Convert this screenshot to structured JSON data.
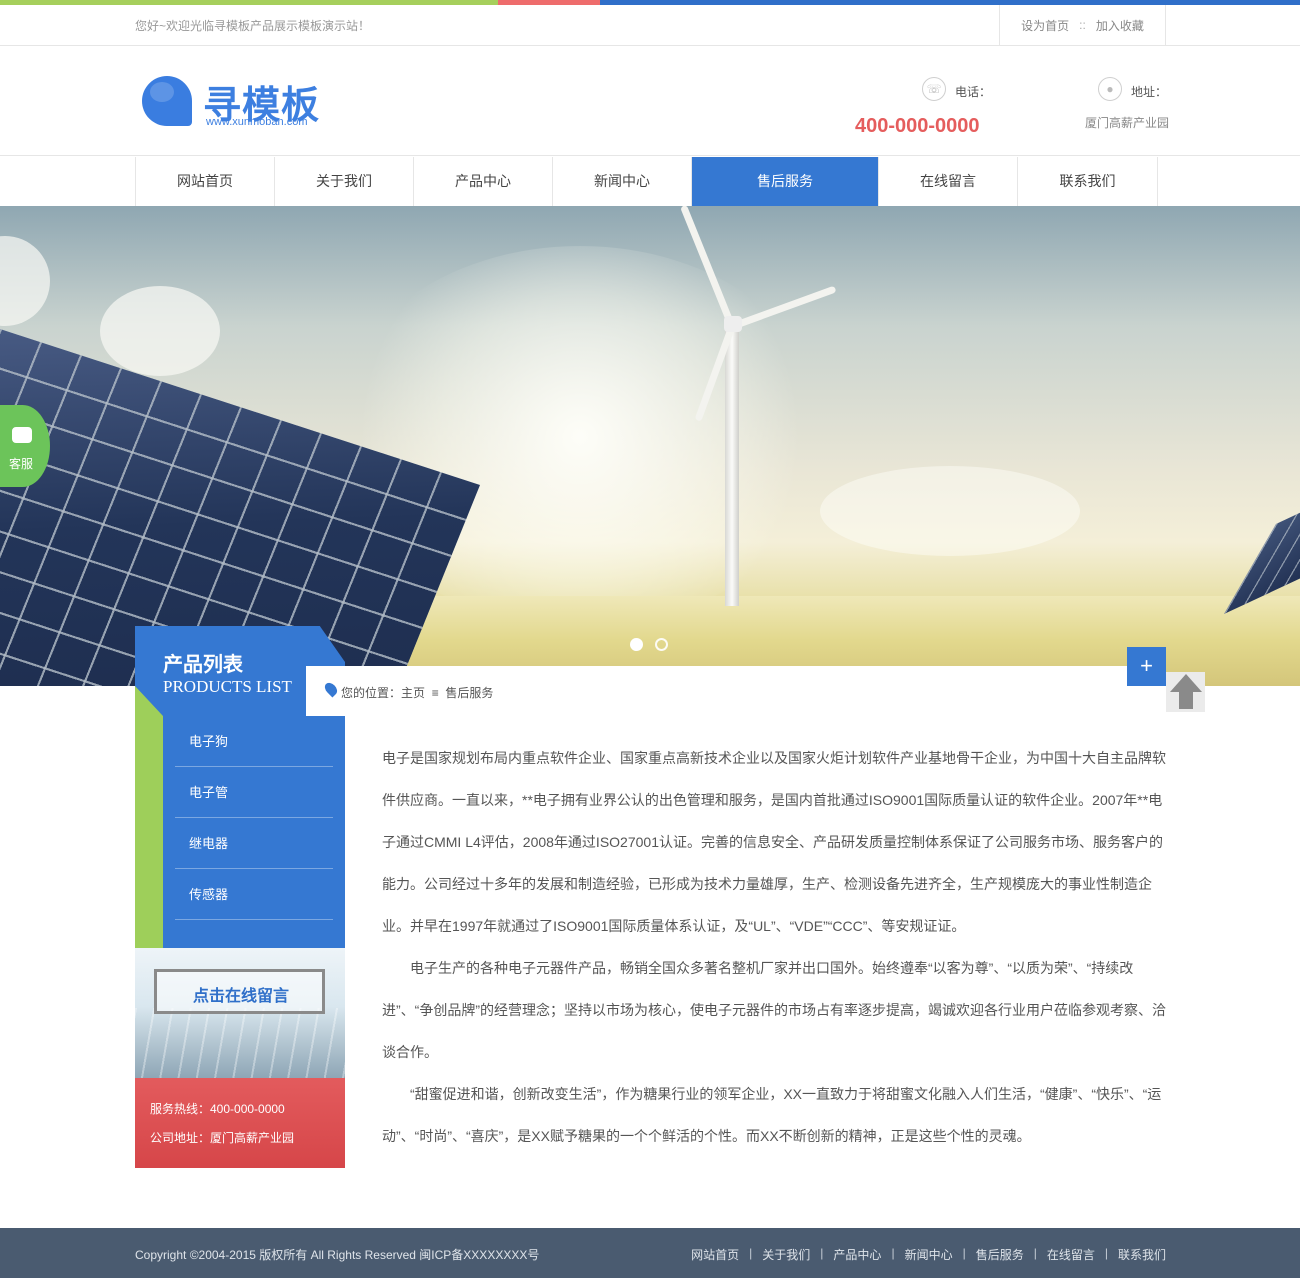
{
  "topbar": {
    "welcome": "您好~欢迎光临寻模板产品展示模板演示站！",
    "set_home": "设为首页",
    "separator": "::",
    "add_favorite": "加入收藏"
  },
  "header": {
    "logo_text": "寻模板",
    "logo_url": "www.xunmoban.com",
    "phone_label": "电话：",
    "phone_number": "400-000-0000",
    "address_label": "地址：",
    "address_value": "厦门高薪产业园"
  },
  "nav": {
    "items": [
      {
        "label": "网站首页"
      },
      {
        "label": "关于我们"
      },
      {
        "label": "产品中心"
      },
      {
        "label": "新闻中心"
      },
      {
        "label": "售后服务"
      },
      {
        "label": "在线留言"
      },
      {
        "label": "联系我们"
      }
    ],
    "active_index": 4
  },
  "floating": {
    "kefu_label": "客服",
    "plus_label": "+"
  },
  "sidebar": {
    "title": "产品列表",
    "subtitle": "PRODUCTS LIST",
    "items": [
      {
        "label": "电子狗"
      },
      {
        "label": "电子管"
      },
      {
        "label": "继电器"
      },
      {
        "label": "传感器"
      }
    ],
    "message_button": "点击在线留言",
    "hotline": "服务热线：400-000-0000",
    "address": "公司地址：厦门高薪产业园"
  },
  "breadcrumb": {
    "prefix": "您的位置：",
    "home": "主页",
    "separator": "≡",
    "current": "售后服务"
  },
  "content": {
    "paragraphs": [
      "电子是国家规划布局内重点软件企业、国家重点高新技术企业以及国家火炬计划软件产业基地骨干企业，为中国十大自主品牌软件供应商。一直以来，**电子拥有业界公认的出色管理和服务，是国内首批通过ISO9001国际质量认证的软件企业。2007年**电子通过CMMI L4评估，2008年通过ISO27001认证。完善的信息安全、产品研发质量控制体系保证了公司服务市场、服务客户的能力。公司经过十多年的发展和制造经验，已形成为技术力量雄厚，生产、检测设备先进齐全，生产规模庞大的事业性制造企业。并早在1997年就通过了ISO9001国际质量体系认证，及“UL”、“VDE”“CCC”、等安规证证。",
      "电子生产的各种电子元器件产品，畅销全国众多著名整机厂家并出口国外。始终遵奉“以客为尊”、“以质为荣”、“持续改进”、“争创品牌”的经营理念；坚持以市场为核心，使电子元器件的市场占有率逐步提高，竭诚欢迎各行业用户莅临参观考察、洽谈合作。",
      "“甜蜜促进和谐，创新改变生活”，作为糖果行业的领军企业，XX一直致力于将甜蜜文化融入人们生活，“健康”、“快乐”、“运动”、“时尚”、“喜庆”，是XX赋予糖果的一个个鲜活的个性。而XX不断创新的精神，正是这些个性的灵魂。"
    ]
  },
  "footer": {
    "copyright": "Copyright ©2004-2015 版权所有 All Rights Reserved 闽ICP备XXXXXXXX号",
    "links": [
      {
        "label": "网站首页"
      },
      {
        "label": "关于我们"
      },
      {
        "label": "产品中心"
      },
      {
        "label": "新闻中心"
      },
      {
        "label": "售后服务"
      },
      {
        "label": "在线留言"
      },
      {
        "label": "联系我们"
      }
    ],
    "separator": "|"
  },
  "colors": {
    "brand_blue": "#3578d2",
    "accent_green": "#9ecf5a",
    "accent_red": "#e35b5d",
    "footer_bg": "#4a5b70"
  }
}
